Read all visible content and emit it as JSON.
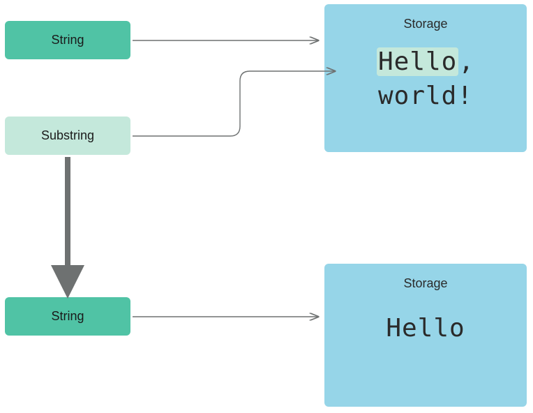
{
  "nodes": {
    "string_top": {
      "label": "String"
    },
    "substring": {
      "label": "Substring"
    },
    "string_bottom": {
      "label": "String"
    }
  },
  "storage": {
    "top": {
      "title": "Storage",
      "highlighted": "Hello",
      "rest_line1": ",",
      "line2": "world!"
    },
    "bottom": {
      "title": "Storage",
      "content": "Hello"
    }
  },
  "colors": {
    "string_box": "#50c3a5",
    "substring_box": "#c4e8db",
    "storage_box": "#96d5e8",
    "arrow": "#6e7171",
    "thick_arrow": "#6e7171"
  }
}
